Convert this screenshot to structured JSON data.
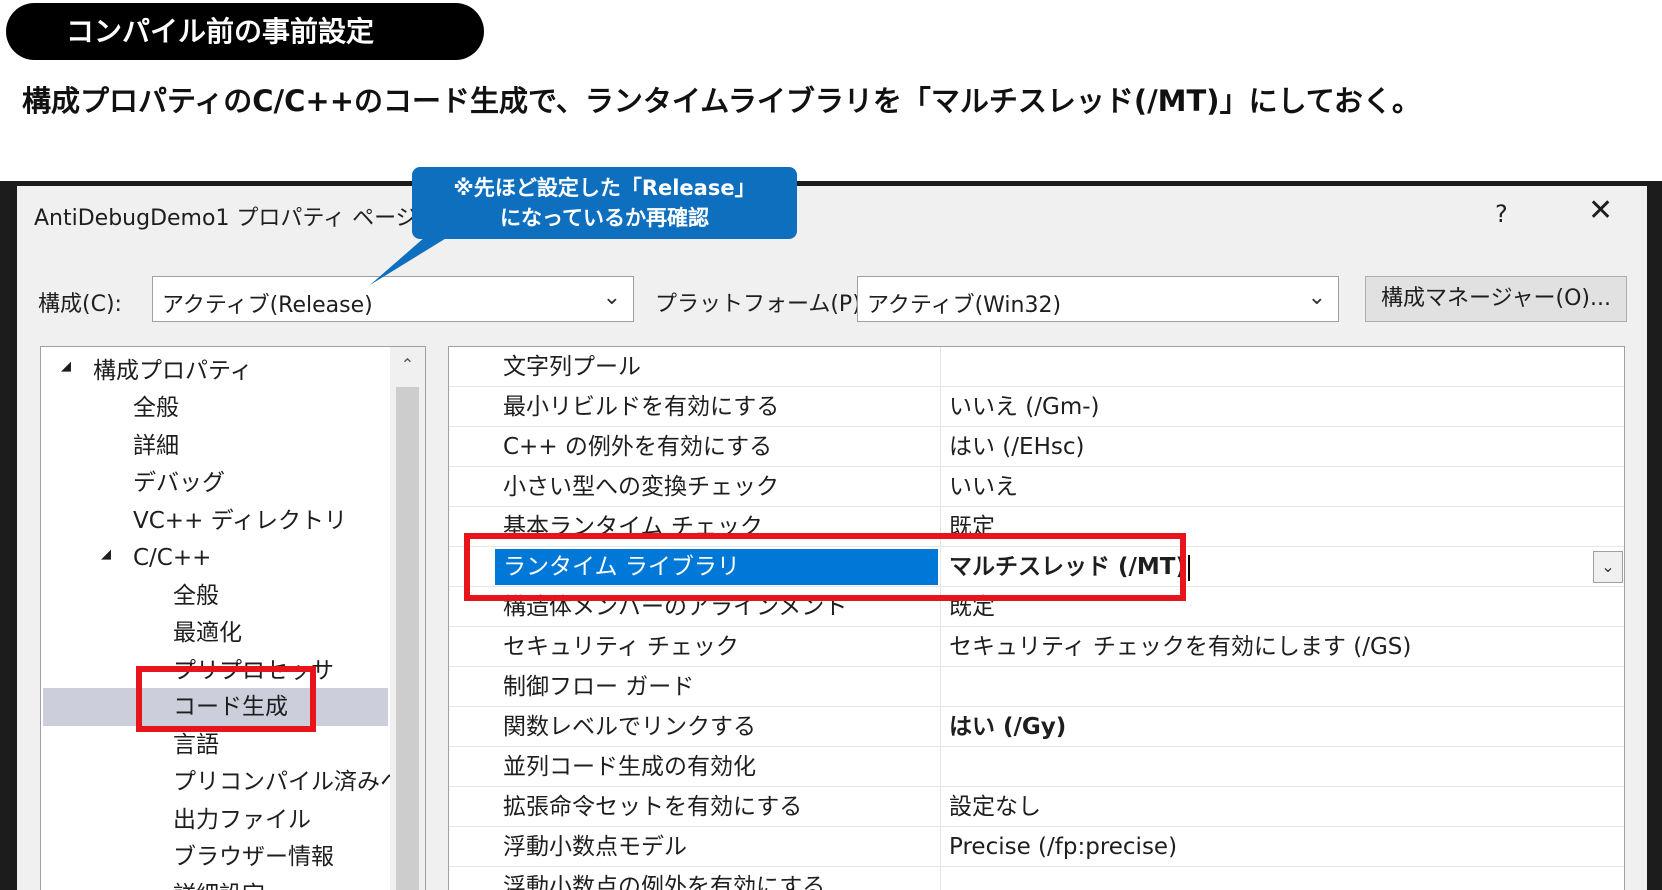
{
  "header": {
    "pill_title": "コンパイル前の事前設定",
    "subtitle": "構成プロパティのC/C++のコード生成で、ランタイムライブラリを「マルチスレッド(/MT)」にしておく。"
  },
  "callout": {
    "line1": "※先ほど設定した「Release」",
    "line2": "になっているか再確認"
  },
  "dialog": {
    "title": "AntiDebugDemo1 プロパティ ページ",
    "help": "?",
    "close": "✕",
    "config_label": "構成(C):",
    "config_value": "アクティブ(Release)",
    "platform_label": "プラットフォーム(P):",
    "platform_value": "アクティブ(Win32)",
    "config_manager_button": "構成マネージャー(O)..."
  },
  "tree": {
    "items": [
      {
        "label": "構成プロパティ"
      },
      {
        "label": "全般"
      },
      {
        "label": "詳細"
      },
      {
        "label": "デバッグ"
      },
      {
        "label": "VC++ ディレクトリ"
      },
      {
        "label": "C/C++"
      },
      {
        "label": "全般"
      },
      {
        "label": "最適化"
      },
      {
        "label": "プリプロセッサ"
      },
      {
        "label": "コード生成"
      },
      {
        "label": "言語"
      },
      {
        "label": "プリコンパイル済みヘッ"
      },
      {
        "label": "出力ファイル"
      },
      {
        "label": "ブラウザー情報"
      },
      {
        "label": "詳細設定"
      }
    ],
    "selected": "コード生成"
  },
  "properties": {
    "rows": [
      {
        "name": "文字列プール",
        "value": ""
      },
      {
        "name": "最小リビルドを有効にする",
        "value": "いいえ (/Gm-)"
      },
      {
        "name": "C++ の例外を有効にする",
        "value": "はい (/EHsc)"
      },
      {
        "name": "小さい型への変換チェック",
        "value": "いいえ"
      },
      {
        "name": "基本ランタイム チェック",
        "value": "既定"
      },
      {
        "name": "ランタイム ライブラリ",
        "value": "マルチスレッド (/MT)"
      },
      {
        "name": "構造体メンバーのアラインメント",
        "value": "既定"
      },
      {
        "name": "セキュリティ チェック",
        "value": "セキュリティ チェックを有効にします (/GS)"
      },
      {
        "name": "制御フロー ガード",
        "value": ""
      },
      {
        "name": "関数レベルでリンクする",
        "value": "はい (/Gy)"
      },
      {
        "name": "並列コード生成の有効化",
        "value": ""
      },
      {
        "name": "拡張命令セットを有効にする",
        "value": "設定なし"
      },
      {
        "name": "浮動小数点モデル",
        "value": "Precise (/fp:precise)"
      },
      {
        "name": "浮動小数点の例外を有効にする",
        "value": ""
      }
    ],
    "selected_row": "ランタイム ライブラリ"
  },
  "colors": {
    "highlight_red": "#e8141b",
    "callout_blue": "#0e6fbe",
    "selection_blue": "#0078d7",
    "tree_selection": "#cccedb"
  }
}
